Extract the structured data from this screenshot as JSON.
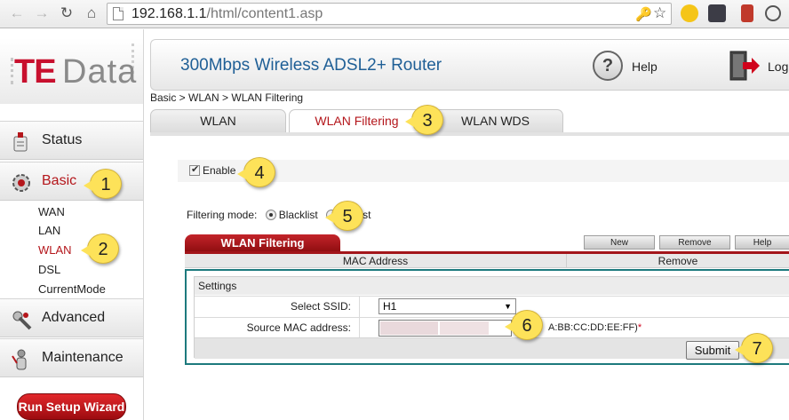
{
  "browser": {
    "url_host": "192.168.1.1",
    "url_path": "/html/content1.asp"
  },
  "sidebar": {
    "logo_te": "TE",
    "logo_data": "Data",
    "status_label": "Status",
    "basic_label": "Basic",
    "sub_items": [
      "WAN",
      "LAN",
      "WLAN",
      "DSL",
      "CurrentMode"
    ],
    "advanced_label": "Advanced",
    "maintenance_label": "Maintenance",
    "wizard_label": "Run Setup Wizard"
  },
  "header": {
    "title": "300Mbps Wireless ADSL2+ Router",
    "help_label": "Help",
    "logout_label": "Log"
  },
  "breadcrumb": "Basic > WLAN > WLAN Filtering",
  "tabs": [
    "WLAN",
    "WLAN Filtering",
    "WLAN WDS"
  ],
  "enable_label": "Enable",
  "filtering": {
    "label": "Filtering mode:",
    "blacklist": "Blacklist",
    "whitelist_partial": "elist"
  },
  "panel": {
    "title": "WLAN Filtering",
    "buttons": [
      "New",
      "Remove",
      "Help"
    ],
    "columns": [
      "MAC Address",
      "Remove"
    ]
  },
  "settings": {
    "title": "Settings",
    "ssid_label": "Select SSID:",
    "ssid_value": "H1",
    "mac_label": "Source MAC address:",
    "mac_hint": "A:BB:CC:DD:EE:FF)",
    "required_mark": "*",
    "submit_label": "Submit"
  },
  "callouts": [
    "1",
    "2",
    "3",
    "4",
    "5",
    "6",
    "7"
  ],
  "colors": {
    "brand_red": "#b4161b",
    "callout_yellow": "#fde259",
    "title_blue": "#1f5f96",
    "settings_border": "#1d7a7d"
  }
}
